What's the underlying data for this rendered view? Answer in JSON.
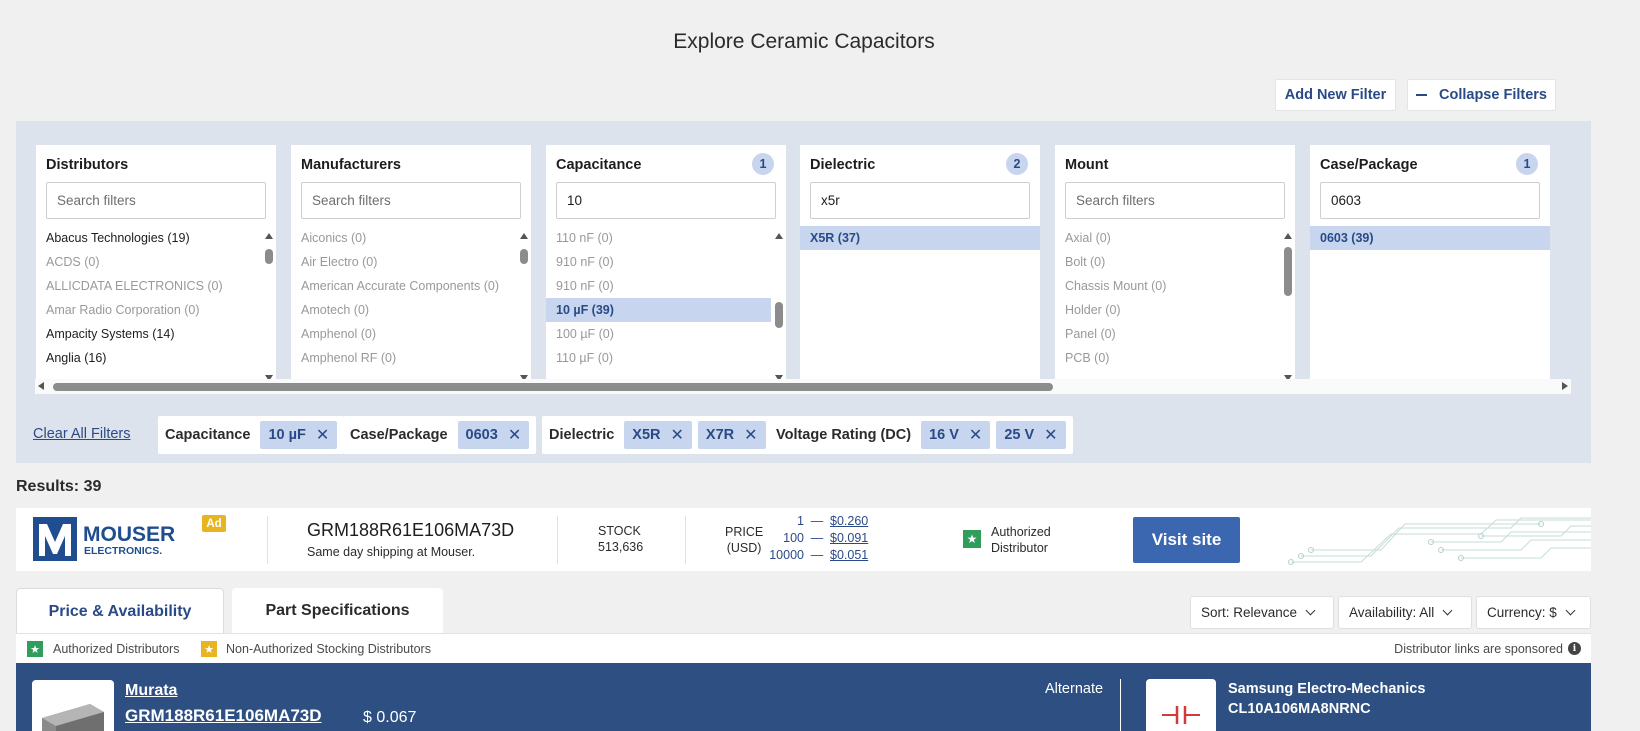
{
  "page_title": "Explore Ceramic Capacitors",
  "header": {
    "add_filter": "Add New Filter",
    "collapse_filters": "Collapse Filters"
  },
  "filters": [
    {
      "title": "Distributors",
      "badge": "",
      "search_value": "",
      "placeholder": "Search filters",
      "options": [
        {
          "label": "Abacus Technologies (19)",
          "state": "dark"
        },
        {
          "label": "ACDS (0)",
          "state": "muted"
        },
        {
          "label": "ALLICDATA ELECTRONICS (0)",
          "state": "muted"
        },
        {
          "label": "Amar Radio Corporation (0)",
          "state": "muted"
        },
        {
          "label": "Ampacity Systems (14)",
          "state": "dark"
        },
        {
          "label": "Anglia (16)",
          "state": "dark"
        }
      ],
      "scroll_position": 0.05,
      "scroll_visible_fraction": 0.12
    },
    {
      "title": "Manufacturers",
      "badge": "",
      "search_value": "",
      "placeholder": "Search filters",
      "options": [
        {
          "label": "Aiconics (0)",
          "state": "muted"
        },
        {
          "label": "Air Electro (0)",
          "state": "muted"
        },
        {
          "label": "American Accurate Components (0)",
          "state": "muted"
        },
        {
          "label": "Amotech (0)",
          "state": "muted"
        },
        {
          "label": "Amphenol (0)",
          "state": "muted"
        },
        {
          "label": "Amphenol RF (0)",
          "state": "muted"
        }
      ],
      "scroll_position": 0.05,
      "scroll_visible_fraction": 0.12
    },
    {
      "title": "Capacitance",
      "badge": "1",
      "search_value": "10",
      "placeholder": "Search filters",
      "options": [
        {
          "label": "110 nF (0)",
          "state": "muted"
        },
        {
          "label": "910 nF (0)",
          "state": "muted"
        },
        {
          "label": "910 nF (0)",
          "state": "muted"
        },
        {
          "label": "10 µF (39)",
          "state": "selected"
        },
        {
          "label": "100 µF (0)",
          "state": "muted"
        },
        {
          "label": "110 µF (0)",
          "state": "muted"
        }
      ],
      "scroll_position": 0.58,
      "scroll_visible_fraction": 0.2
    },
    {
      "title": "Dielectric",
      "badge": "2",
      "search_value": "x5r",
      "placeholder": "Search filters",
      "options": [
        {
          "label": "X5R (37)",
          "state": "selected-full"
        }
      ]
    },
    {
      "title": "Mount",
      "badge": "",
      "search_value": "",
      "placeholder": "Search filters",
      "options": [
        {
          "label": "Axial (0)",
          "state": "muted"
        },
        {
          "label": "Bolt (0)",
          "state": "muted"
        },
        {
          "label": "Chassis Mount (0)",
          "state": "muted"
        },
        {
          "label": "Holder (0)",
          "state": "muted"
        },
        {
          "label": "Panel (0)",
          "state": "muted"
        },
        {
          "label": "PCB (0)",
          "state": "muted"
        }
      ],
      "scroll_position": 0.05,
      "scroll_visible_fraction": 0.38
    },
    {
      "title": "Case/Package",
      "badge": "1",
      "search_value": "0603",
      "placeholder": "Search filters",
      "options": [
        {
          "label": "0603 (39)",
          "state": "selected-full"
        }
      ]
    }
  ],
  "active_filters": {
    "clear_all": "Clear All Filters",
    "groups": [
      {
        "label": "Capacitance",
        "chips": [
          "10 µF"
        ]
      },
      {
        "label": "Case/Package",
        "chips": [
          "0603"
        ]
      },
      {
        "label": "Dielectric",
        "chips": [
          "X5R",
          "X7R"
        ]
      },
      {
        "label": "Voltage Rating (DC)",
        "chips": [
          "16 V",
          "25 V"
        ]
      }
    ]
  },
  "results_label": "Results: 39",
  "ad": {
    "logo_main": "MOUSER",
    "logo_sub": "ELECTRONICS.",
    "badge": "Ad",
    "part_number": "GRM188R61E106MA73D",
    "subtitle": "Same day shipping at Mouser.",
    "stock_label": "STOCK",
    "stock_value": "513,636",
    "price_label_1": "PRICE",
    "price_label_2": "(USD)",
    "prices": [
      {
        "qty": "1",
        "dash": "—",
        "price": "$0.260"
      },
      {
        "qty": "100",
        "dash": "—",
        "price": "$0.091"
      },
      {
        "qty": "10000",
        "dash": "—",
        "price": "$0.051"
      }
    ],
    "authorized_1": "Authorized",
    "authorized_2": "Distributor",
    "visit_button": "Visit site"
  },
  "tabs": [
    {
      "label": "Price & Availability",
      "active": true
    },
    {
      "label": "Part Specifications",
      "active": false
    }
  ],
  "dropdowns": {
    "sort": "Sort: Relevance",
    "availability": "Availability: All",
    "currency": "Currency: $"
  },
  "legend": {
    "authorized": "Authorized Distributors",
    "non_authorized": "Non-Authorized Stocking Distributors",
    "sponsored": "Distributor links are sponsored"
  },
  "result": {
    "manufacturer": "Murata",
    "part_number": "GRM188R61E106MA73D",
    "price": "$ 0.067",
    "alternate_label": "Alternate",
    "alt_manufacturer": "Samsung Electro-Mechanics",
    "alt_part_number": "CL10A106MA8NRNC"
  },
  "colors": {
    "brand_blue": "#2a4a87",
    "chip_bg": "#c7d6ee",
    "filter_area_bg": "#dde3ec",
    "row_bg": "#2d4f81",
    "visit_button": "#3a67b0",
    "authorized_star": "#2f9e5a",
    "non_authorized_star": "#e8b422"
  },
  "icons": {
    "collapse": "minus-icon",
    "remove_chip": "close-icon",
    "dropdown": "chevron-down-icon",
    "authorized": "star-icon",
    "info": "info-icon"
  }
}
